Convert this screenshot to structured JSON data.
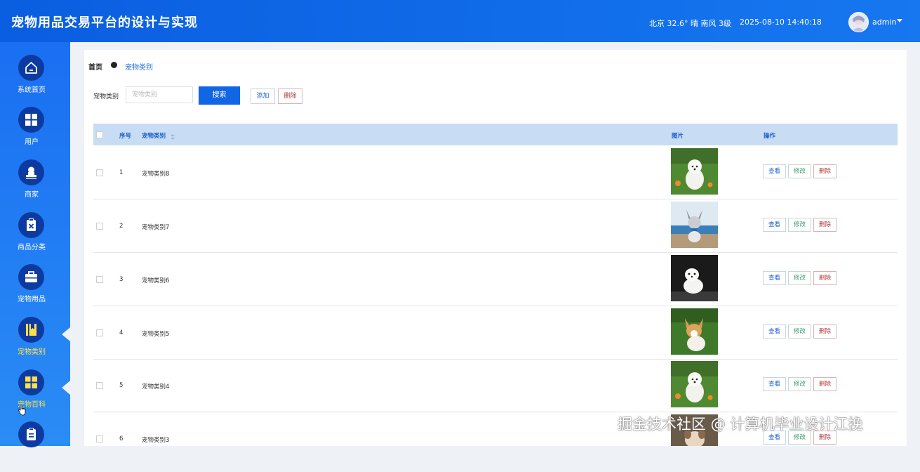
{
  "header": {
    "title": "宠物用品交易平台的设计与实现",
    "weather": "北京  32.6°  晴  南风  3级",
    "datetime": "2025-08-10 14:40:18",
    "user": "admin"
  },
  "sidebar": {
    "items": [
      {
        "label": "系统首页",
        "icon": "home-icon"
      },
      {
        "label": "用户",
        "icon": "grid-icon"
      },
      {
        "label": "商家",
        "icon": "user-stamp-icon"
      },
      {
        "label": "商品分类",
        "icon": "clipboard-x-icon"
      },
      {
        "label": "宠物用品",
        "icon": "briefcase-icon"
      },
      {
        "label": "宠物类别",
        "icon": "book-icon",
        "active": true
      },
      {
        "label": "宠物百科",
        "icon": "grid-icon"
      },
      {
        "label": "",
        "icon": "clipboard-icon"
      }
    ],
    "active_label_color": "#ffe04a"
  },
  "breadcrumb": {
    "home": "首页",
    "current": "宠物类别"
  },
  "filter": {
    "label": "宠物类别",
    "placeholder": "宠物类别",
    "search_label": "搜索",
    "add_label": "添加",
    "delete_label": "删除"
  },
  "table": {
    "headers": {
      "index": "序号",
      "category": "宠物类别",
      "image": "图片",
      "actions": "操作"
    },
    "action_labels": {
      "view": "查看",
      "edit": "修改",
      "delete": "删除"
    },
    "rows": [
      {
        "index": "1",
        "category": "宠物类别8",
        "image": "white-puppy-on-grass"
      },
      {
        "index": "2",
        "category": "宠物类别7",
        "image": "husky-puppy-by-sea"
      },
      {
        "index": "3",
        "category": "宠物类别6",
        "image": "white-ferret"
      },
      {
        "index": "4",
        "category": "宠物类别5",
        "image": "corgi-puppy"
      },
      {
        "index": "5",
        "category": "宠物类别4",
        "image": "white-puppy-on-grass"
      },
      {
        "index": "6",
        "category": "宠物类别3",
        "image": "puppy"
      }
    ]
  },
  "watermark": "掘金技术社区 @ 计算机毕业设计江挽",
  "colors": {
    "header": "#0a5ee0",
    "sidebar": "#1a6ff2",
    "icon_circle": "#0c3aa0",
    "table_header": "#c8dcf4"
  }
}
